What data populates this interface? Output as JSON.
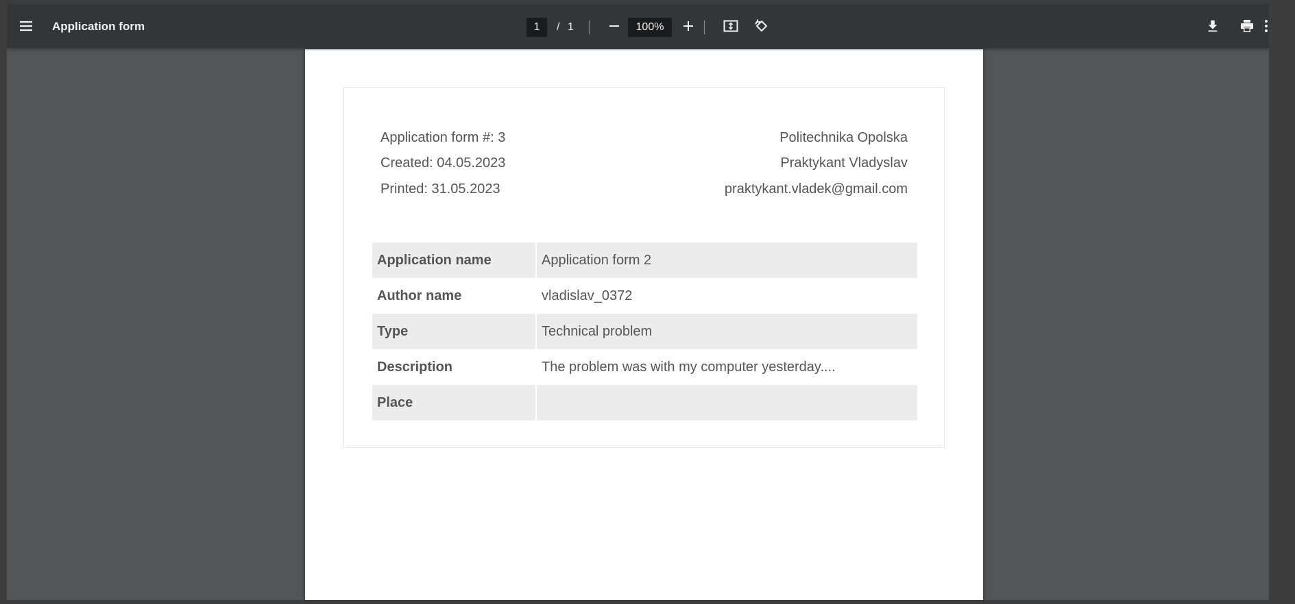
{
  "toolbar": {
    "title": "Application form",
    "current_page": "1",
    "page_separator": "/",
    "total_pages": "1",
    "zoom": "100%",
    "icons": {
      "menu": "hamburger-icon",
      "zoom_out": "minus-icon",
      "zoom_in": "plus-icon",
      "fit": "fit-to-page-icon",
      "rotate": "rotate-icon",
      "download": "download-icon",
      "print": "print-icon",
      "more": "more-vertical-icon"
    }
  },
  "document": {
    "header_left": [
      "Application form #: 3",
      "Created: 04.05.2023",
      "Printed: 31.05.2023"
    ],
    "header_right": [
      "Politechnika Opolska",
      "Praktykant Vladyslav",
      "praktykant.vladek@gmail.com"
    ],
    "rows": [
      {
        "label": "Application name",
        "value": "Application form 2"
      },
      {
        "label": "Author name",
        "value": "vladislav_0372"
      },
      {
        "label": "Type",
        "value": "Technical problem"
      },
      {
        "label": "Description",
        "value": "The problem was with my computer yesterday...."
      },
      {
        "label": "Place",
        "value": ""
      }
    ]
  },
  "colors": {
    "toolbar_bg": "#323639",
    "viewer_bg": "#525659",
    "page_bg": "#ffffff",
    "row_shade": "#ececec",
    "text": "#555555"
  }
}
